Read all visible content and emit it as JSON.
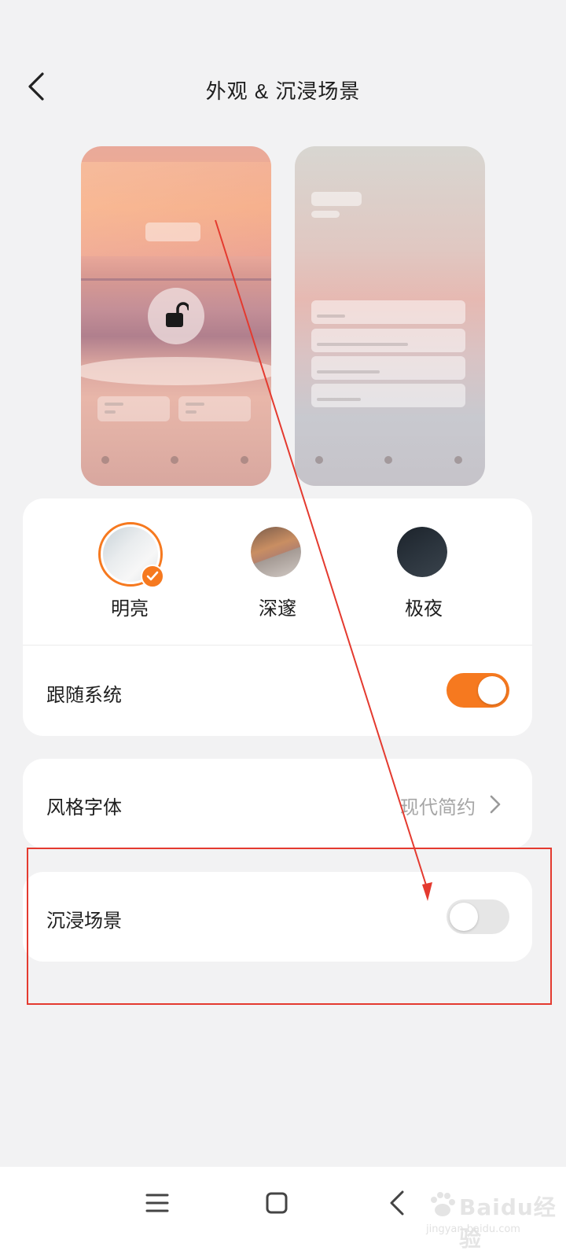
{
  "header": {
    "title": "外观 & 沉浸场景"
  },
  "themes": [
    {
      "label": "明亮",
      "selected": true,
      "thumb_icon": "seaside-thumbnail"
    },
    {
      "label": "深邃",
      "selected": false,
      "thumb_icon": "sunset-thumbnail"
    },
    {
      "label": "极夜",
      "selected": false,
      "thumb_icon": "night-thumbnail"
    }
  ],
  "follow_system": {
    "label": "跟随系统",
    "enabled": true
  },
  "font_style": {
    "label": "风格字体",
    "value": "现代简约"
  },
  "immersive_scene": {
    "label": "沉浸场景",
    "enabled": false
  },
  "colors": {
    "accent": "#f6791f",
    "annotation": "#e43a2f",
    "background": "#f2f2f3"
  },
  "watermark": {
    "brand": "Baidu经验",
    "url": "jingyan.baidu.com"
  }
}
